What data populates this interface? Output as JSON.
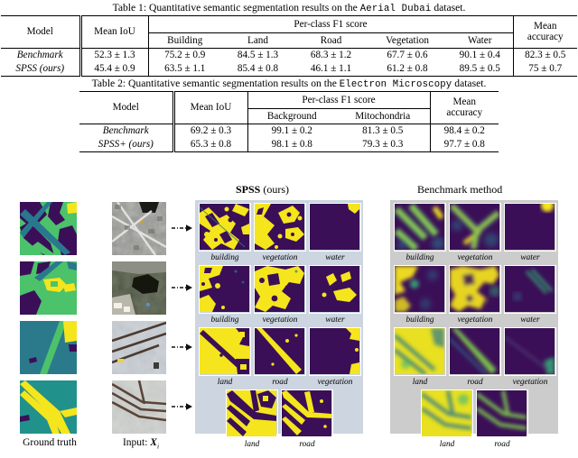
{
  "table1": {
    "caption_pre": "Table 1: Quantitative semantic segmentation results on the ",
    "caption_mono": "Aerial Dubai",
    "caption_post": " dataset.",
    "group_header": "Per-class F1 score",
    "headers": {
      "model": "Model",
      "mean_iou": "Mean IoU",
      "mean_acc_l1": "Mean",
      "mean_acc_l2": "accuracy"
    },
    "subheaders": [
      "Building",
      "Land",
      "Road",
      "Vegetation",
      "Water"
    ],
    "rows": [
      {
        "model": "Benchmark",
        "mean_iou": "52.3 ± 1.3",
        "per_class": [
          "75.2 ± 0.9",
          "84.5 ± 1.3",
          "68.3 ± 1.2",
          "67.7 ± 0.6",
          "90.1 ± 0.4"
        ],
        "mean_accuracy": "82.3 ± 0.5"
      },
      {
        "model": "SPSS (ours)",
        "mean_iou": "45.4 ± 0.9",
        "per_class": [
          "63.5 ± 1.1",
          "85.4 ± 0.8",
          "46.1 ± 1.1",
          "61.2 ± 0.8",
          "89.5 ± 0.5"
        ],
        "mean_accuracy": "75 ± 0.7"
      }
    ]
  },
  "table2": {
    "caption_pre": "Table 2: Quantitative semantic segmentation results on the ",
    "caption_mono": "Electron Microscopy",
    "caption_post": " dataset.",
    "group_header": "Per-class F1 score",
    "headers": {
      "model": "Model",
      "mean_iou": "Mean IoU",
      "mean_acc_l1": "Mean",
      "mean_acc_l2": "accuracy"
    },
    "subheaders": [
      "Background",
      "Mitochondria"
    ],
    "rows": [
      {
        "model": "Benchmark",
        "mean_iou": "69.2 ± 0.3",
        "per_class": [
          "99.1 ± 0.2",
          "81.3 ± 0.5"
        ],
        "mean_accuracy": "98.4 ± 0.2"
      },
      {
        "model": "SPSS+ (ours)",
        "mean_iou": "65.3 ± 0.8",
        "per_class": [
          "98.1 ± 0.8",
          "79.3 ± 0.3"
        ],
        "mean_accuracy": "97.7 ± 0.8"
      }
    ]
  },
  "figure": {
    "titles": {
      "spss_bold": "SPSS",
      "spss_rest": " (ours)",
      "benchmark": "Benchmark method"
    },
    "column_labels": {
      "ground_truth": "Ground truth",
      "input": "Input: "
    },
    "input_symbol": "X",
    "input_subscript": "i",
    "rows": [
      {
        "labels": [
          "building",
          "vegetation",
          "water"
        ]
      },
      {
        "labels": [
          "building",
          "vegetation",
          "water"
        ]
      },
      {
        "labels": [
          "land",
          "road",
          "vegetation"
        ]
      },
      {
        "labels": [
          "land",
          "road"
        ]
      }
    ],
    "colors": {
      "panel_spss_bg": "#ccd5e0",
      "panel_benchmark_bg": "#cccccc",
      "viridis_dark": "#3b0f57",
      "viridis_yellow": "#f5e51c",
      "viridis_green": "#4cc26b",
      "viridis_teal": "#2a788e",
      "tile_border": "#ffffff"
    }
  }
}
